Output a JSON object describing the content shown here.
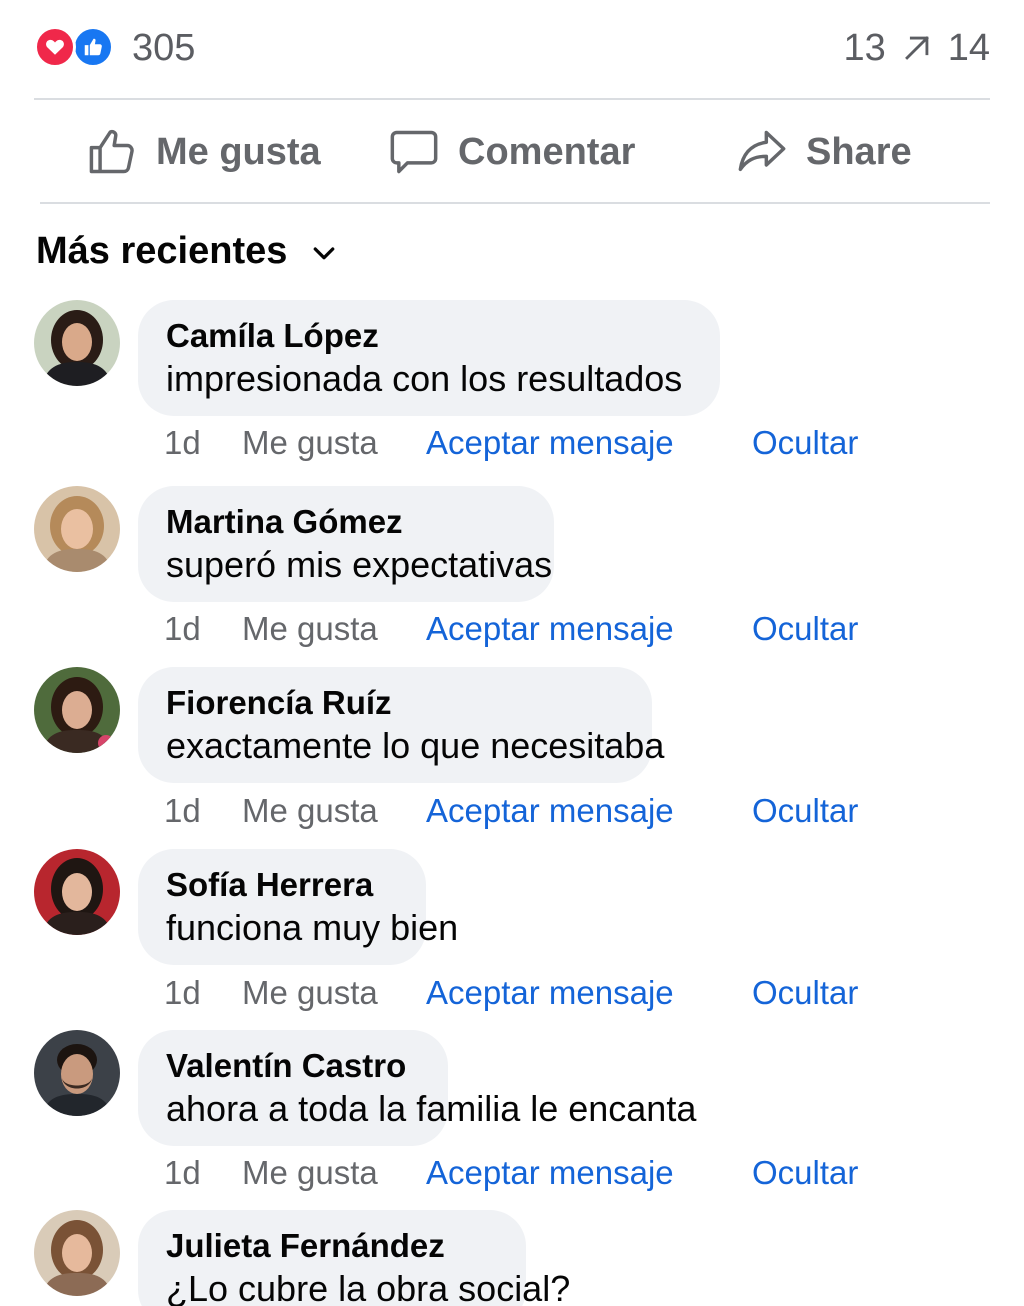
{
  "reactions": {
    "icons": [
      "heart-icon",
      "thumbs-up-icon"
    ],
    "count": "305",
    "comments_count": "13",
    "shares_count": "14",
    "share_icon": "arrow-up-right-icon",
    "colors": {
      "love": "#f0284a",
      "like": "#1877f2"
    }
  },
  "actions": {
    "like_label": "Me gusta",
    "comment_label": "Comentar",
    "share_label": "Share"
  },
  "sort": {
    "label": "Más recientes"
  },
  "comments": [
    {
      "author": "Camíla López",
      "text": "impresionada con los resultados",
      "time": "1d",
      "like": "Me gusta",
      "accept": "Aceptar mensaje",
      "hide": "Ocultar"
    },
    {
      "author": "Martina Gómez",
      "text": "superó mis expectativas",
      "time": "1d",
      "like": "Me gusta",
      "accept": "Aceptar mensaje",
      "hide": "Ocultar"
    },
    {
      "author": "Fiorencía Ruíz",
      "text": "exactamente lo que necesitaba",
      "time": "1d",
      "like": "Me gusta",
      "accept": "Aceptar mensaje",
      "hide": "Ocultar"
    },
    {
      "author": "Sofía Herrera",
      "text": "funciona muy bien",
      "time": "1d",
      "like": "Me gusta",
      "accept": "Aceptar mensaje",
      "hide": "Ocultar"
    },
    {
      "author": "Valentín Castro",
      "text": "ahora a toda la familia le encanta",
      "time": "1d",
      "like": "Me gusta",
      "accept": "Aceptar mensaje",
      "hide": "Ocultar"
    },
    {
      "author": "Julieta Fernández",
      "text": "¿Lo cubre la obra social?"
    }
  ],
  "colors": {
    "link": "#1464d8",
    "muted": "#65676b",
    "bubble": "#f0f2f5"
  }
}
